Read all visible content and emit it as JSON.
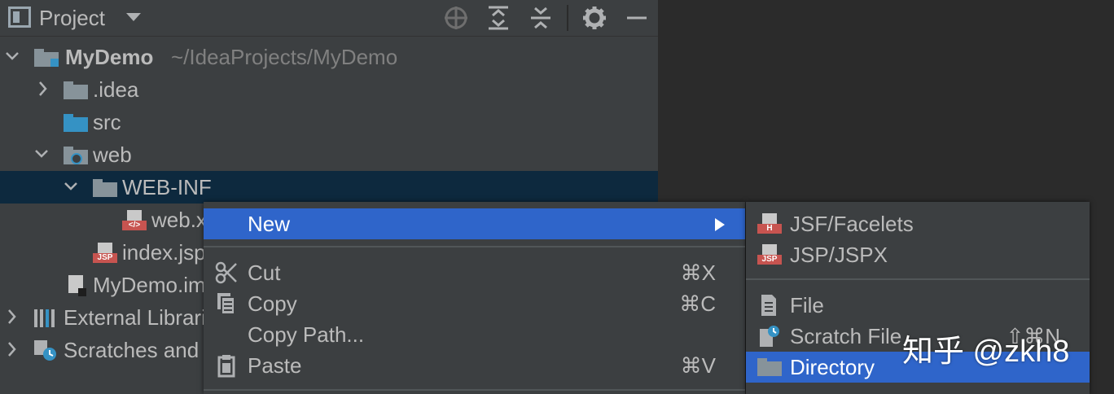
{
  "header": {
    "title": "Project",
    "icons": [
      "project-view-icon",
      "dropdown-icon",
      "locate-icon",
      "expand-all-icon",
      "collapse-all-icon",
      "gear-icon",
      "hide-icon"
    ]
  },
  "tree": [
    {
      "label": "MyDemo",
      "path": "~/IdeaProjects/MyDemo",
      "icon": "module-folder-icon"
    },
    {
      "label": ".idea",
      "icon": "folder-icon"
    },
    {
      "label": "src",
      "icon": "source-folder-icon"
    },
    {
      "label": "web",
      "icon": "web-folder-icon"
    },
    {
      "label": "WEB-INF",
      "icon": "folder-icon"
    },
    {
      "label": "web.xml",
      "icon": "xml-file-icon"
    },
    {
      "label": "index.jsp",
      "icon": "jsp-file-icon"
    },
    {
      "label": "MyDemo.iml",
      "icon": "iml-file-icon"
    },
    {
      "label": "External Libraries",
      "icon": "library-icon"
    },
    {
      "label": "Scratches and Consoles",
      "icon": "scratches-icon"
    }
  ],
  "context_menu": {
    "new": {
      "label": "New"
    },
    "cut": {
      "label": "Cut",
      "shortcut": "⌘X"
    },
    "copy": {
      "label": "Copy",
      "shortcut": "⌘C"
    },
    "copy_path": {
      "label": "Copy Path..."
    },
    "paste": {
      "label": "Paste",
      "shortcut": "⌘V"
    }
  },
  "submenu": {
    "jsf": {
      "label": "JSF/Facelets",
      "badge": "H"
    },
    "jsp": {
      "label": "JSP/JSPX",
      "badge": "JSP"
    },
    "file": {
      "label": "File"
    },
    "scratch": {
      "label": "Scratch File",
      "shortcut": "⇧⌘N"
    },
    "directory": {
      "label": "Directory"
    }
  },
  "watermark": "知乎 @zkh8",
  "colors": {
    "panel": "#3c3f41",
    "editor": "#2b2b2b",
    "selection": "#0d293e",
    "menu_highlight": "#2f65ca",
    "text": "#bbbbbb",
    "path_text": "#808080"
  }
}
